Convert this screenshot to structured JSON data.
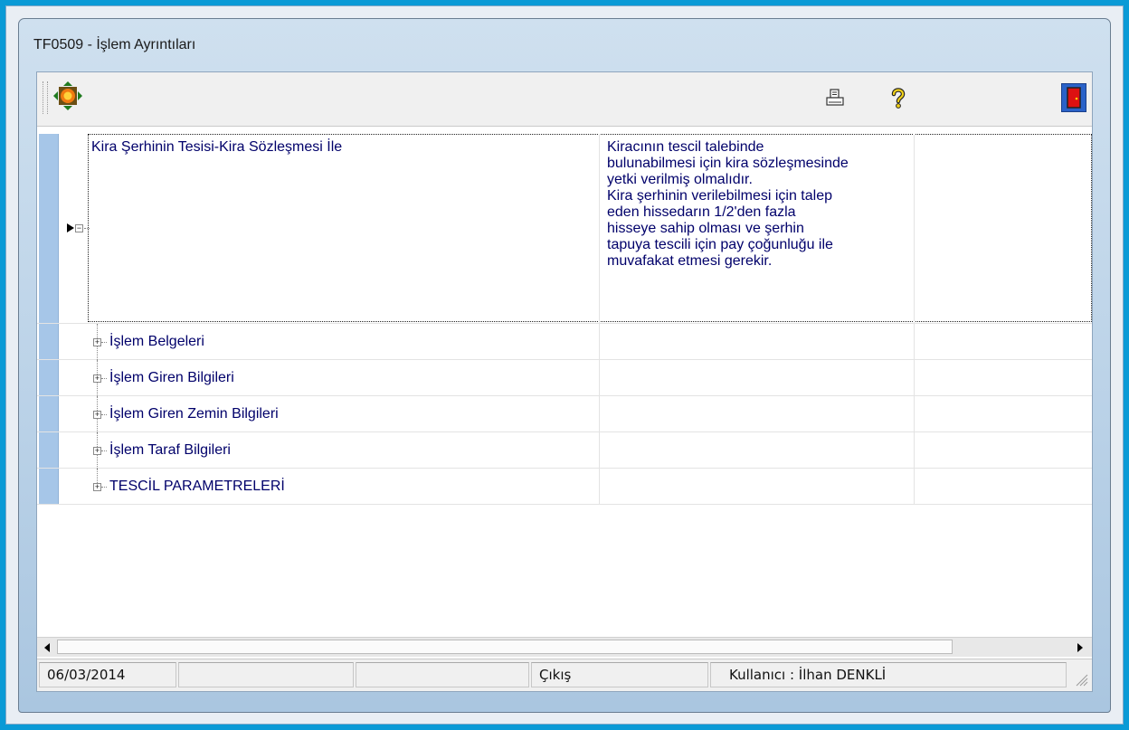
{
  "window": {
    "title": "TF0509 - İşlem Ayrıntıları"
  },
  "toolbar": {
    "nav_icon": "navigator-icon",
    "print_icon": "printer-icon",
    "help_icon": "help-icon",
    "exit_icon": "exit-door-icon"
  },
  "tree": {
    "main_row": {
      "title": "Kira Şerhinin Tesisi-Kira Sözleşmesi İle",
      "note_lines": [
        "Kiracının tescil talebinde",
        "bulunabilmesi için kira sözleşmesinde",
        "yetki verilmiş olmalıdır.",
        "Kira şerhinin verilebilmesi için talep",
        "eden hissedarın 1/2'den fazla",
        "hisseye sahip olması ve şerhin",
        "tapuya tescili için pay çoğunluğu ile",
        "muvafakat etmesi gerekir."
      ]
    },
    "children": [
      {
        "label": "İşlem Belgeleri"
      },
      {
        "label": "İşlem Giren Bilgileri"
      },
      {
        "label": "İşlem Giren Zemin Bilgileri"
      },
      {
        "label": "İşlem Taraf Bilgileri"
      },
      {
        "label": "TESCİL PARAMETRELERİ"
      }
    ]
  },
  "statusbar": {
    "date": "06/03/2014",
    "panel2": "",
    "panel3": "",
    "exit_label": "Çıkış",
    "user": "Kullanıcı : İlhan  DENKLİ"
  },
  "colors": {
    "accent": "#0a9ad6",
    "text": "#00006a",
    "indicator": "#a6c6e8"
  }
}
